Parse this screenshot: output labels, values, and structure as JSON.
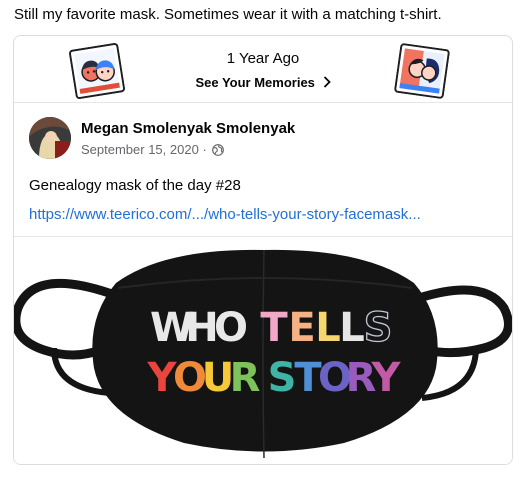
{
  "caption": "Still my favorite mask. Sometimes wear it with a matching t-shirt.",
  "memories": {
    "title": "1 Year Ago",
    "link_label": "See Your Memories",
    "chevron_icon": "chevron-right-icon"
  },
  "post": {
    "author": "Megan Smolenyak Smolenyak",
    "date": "September 15, 2020",
    "separator": "·",
    "privacy_icon": "globe-icon",
    "text": "Genealogy mask of the day #28",
    "link": "https://www.teerico.com/.../who-tells-your-story-facemask..."
  },
  "photo": {
    "mask_line1": [
      "W",
      "H",
      "O",
      " ",
      "T",
      "E",
      "L",
      "L",
      "S"
    ],
    "mask_line2": [
      "Y",
      "O",
      "U",
      "R",
      " ",
      "S",
      "T",
      "O",
      "R",
      "Y"
    ]
  },
  "colors": {
    "link": "#216fdb",
    "muted": "#65676b",
    "border": "#dadde1",
    "mask": "#141414"
  }
}
